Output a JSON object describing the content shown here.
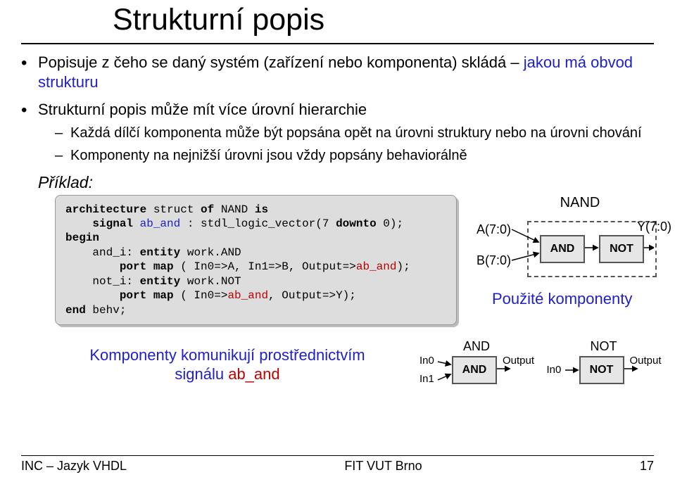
{
  "title": "Strukturní popis",
  "bullets": [
    {
      "pre": "Popisuje z čeho se daný systém (zařízení nebo komponenta) skládá – ",
      "blue": "jakou má obvod strukturu"
    },
    {
      "pre": "Strukturní popis může mít více úrovní hierarchie",
      "blue": ""
    }
  ],
  "subbullets": {
    "s1": "Každá dílčí komponenta může být popsána opět na úrovni struktury nebo na úrovni chování",
    "s2": "Komponenty na nejnižší úrovni jsou vždy popsány behaviorálně"
  },
  "example_label": "Příklad:",
  "code": {
    "l1a": "architecture",
    "l1b": " struct ",
    "l1c": "of",
    "l1d": " NAND ",
    "l1e": "is",
    "l2a": "    signal",
    "l2b": " ab_and",
    "l2c": " : stdl_logic_vector(7 ",
    "l2d": "downto",
    "l2e": " 0);",
    "l3": "begin",
    "l4a": "    and_i: ",
    "l4b": "entity",
    "l4c": " work.AND",
    "l5a": "        port map",
    "l5b": " ( In0=>A, In1=>B, Output=>",
    "l5c": "ab_and",
    "l5d": ");",
    "l6a": "    not_i: ",
    "l6b": "entity",
    "l6c": " work.NOT",
    "l7a": "        port map",
    "l7b": " ( In0=>",
    "l7c": "ab_and",
    "l7d": ", Output=>Y);",
    "l8": "end",
    "l8b": " behv;"
  },
  "diagram": {
    "nand_title": "NAND",
    "A": "A(7:0)",
    "B": "B(7:0)",
    "Y": "Y(7:0)",
    "AND": "AND",
    "NOT": "NOT",
    "used": "Použité komponenty"
  },
  "comm": {
    "line1": "Komponenty komunikují prostřednictvím",
    "line2_pre": "signálu ",
    "line2_red": "ab_and"
  },
  "comps": {
    "and": {
      "title": "AND",
      "in0": "In0",
      "in1": "In1",
      "out": "Output",
      "gate": "AND"
    },
    "not": {
      "title": "NOT",
      "in0": "In0",
      "out": "Output",
      "gate": "NOT"
    }
  },
  "footer": {
    "left": "INC – Jazyk VHDL",
    "mid": "FIT VUT Brno",
    "right": "17"
  }
}
